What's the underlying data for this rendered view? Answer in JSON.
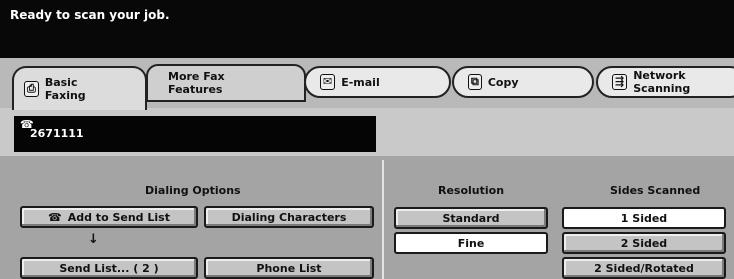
{
  "status": {
    "message": "Ready to scan your job."
  },
  "tabs": {
    "basic_faxing": {
      "label": "Basic\nFaxing"
    },
    "more_fax_features": {
      "label": "More Fax\nFeatures"
    },
    "email": {
      "label": "E-mail"
    },
    "copy": {
      "label": "Copy"
    },
    "network_scanning": {
      "label": "Network\nScanning"
    }
  },
  "fax": {
    "number": "2671111"
  },
  "dialing": {
    "heading": "Dialing Options",
    "add_to_send_list": "Add to Send List",
    "dialing_characters": "Dialing Characters",
    "send_list": "Send List... ( 2 )",
    "phone_list": "Phone List",
    "arrow": "↓"
  },
  "resolution": {
    "heading": "Resolution",
    "options": [
      "Standard",
      "Fine"
    ],
    "selected": "Fine"
  },
  "sides": {
    "heading": "Sides Scanned",
    "options": [
      "1 Sided",
      "2 Sided",
      "2 Sided/Rotated"
    ],
    "selected": "1 Sided"
  }
}
